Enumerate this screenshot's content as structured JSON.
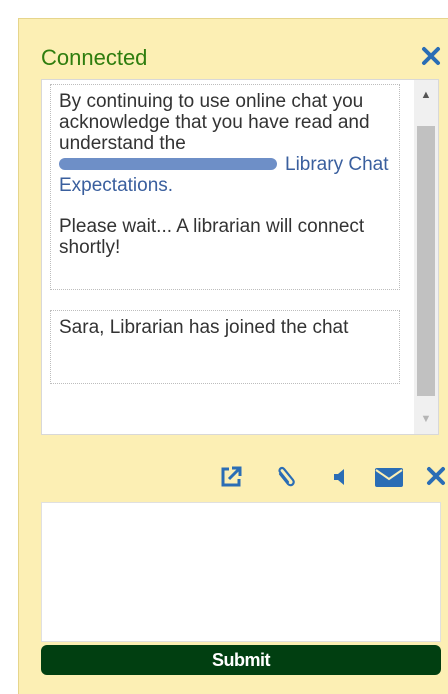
{
  "header": {
    "status": "Connected",
    "close_icon": "close-icon"
  },
  "transcript": {
    "notice": {
      "text": "By continuing to use online chat you acknowledge that you have read and understand the",
      "redacted_link_part": "[redacted]",
      "link_text": "Library Chat Expectations.",
      "wait_text": "Please wait... A librarian will connect shortly!"
    },
    "joined": "Sara, Librarian has joined the chat"
  },
  "toolbar": {
    "icons": [
      "popout-icon",
      "paperclip-icon",
      "sound-icon",
      "email-icon",
      "close-icon"
    ]
  },
  "compose": {
    "value": "",
    "placeholder": ""
  },
  "submit_label": "Submit",
  "colors": {
    "status": "#2e7d0e",
    "icons": "#2a6db5",
    "panel_bg": "#fcefb4",
    "submit_bg": "#013f11",
    "redaction": "#6e8fc7"
  }
}
